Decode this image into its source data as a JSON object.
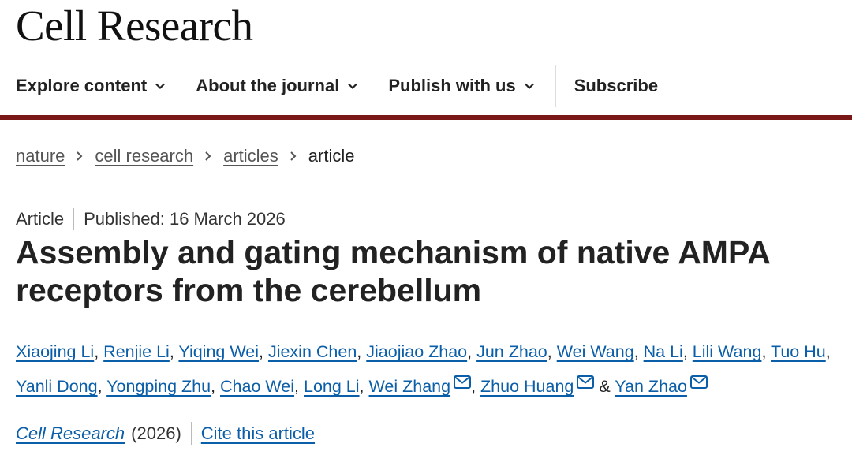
{
  "header": {
    "logo": "Cell Research"
  },
  "nav": {
    "items": [
      {
        "label": "Explore content"
      },
      {
        "label": "About the journal"
      },
      {
        "label": "Publish with us"
      }
    ],
    "subscribe": "Subscribe"
  },
  "breadcrumb": {
    "items": [
      "nature",
      "cell research",
      "articles"
    ],
    "current": "article"
  },
  "article": {
    "type": "Article",
    "published": "Published: 16 March 2026",
    "title": "Assembly and gating mechanism of native AMPA receptors from the cerebellum",
    "authors": [
      "Xiaojing Li",
      "Renjie Li",
      "Yiqing Wei",
      "Jiexin Chen",
      "Jiaojiao Zhao",
      "Jun Zhao",
      "Wei Wang",
      "Na Li",
      "Lili Wang",
      "Tuo Hu",
      "Yanli Dong",
      "Yongping Zhu",
      "Chao Wei",
      "Long Li",
      "Wei Zhang",
      "Zhuo Huang",
      "Yan Zhao"
    ],
    "ampersand": "&",
    "journal": "Cell Research",
    "year": "(2026)",
    "cite_label": "Cite this article"
  },
  "colors": {
    "accent_bar": "#7a1818",
    "link": "#0b5ea8"
  },
  "icons": {
    "nav_dropdown": "chevron-down-icon",
    "breadcrumb_sep": "chevron-right-icon",
    "author_contact": "mail-icon"
  }
}
